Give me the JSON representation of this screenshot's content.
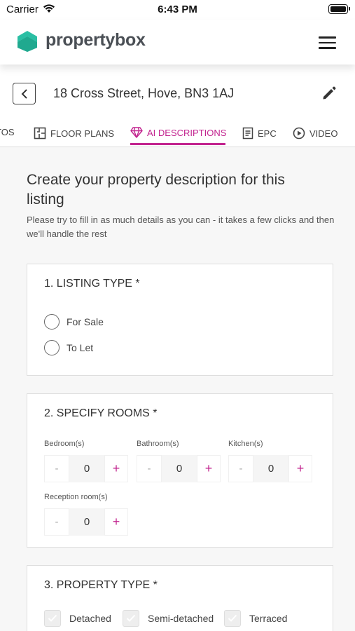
{
  "status_bar": {
    "carrier": "Carrier",
    "time": "6:43 PM"
  },
  "header": {
    "brand": "propertybox"
  },
  "address_bar": {
    "address": "18 Cross Street, Hove, BN3 1AJ"
  },
  "tabs": [
    {
      "label": "TOS",
      "icon": "photos-icon",
      "active": false
    },
    {
      "label": "FLOOR PLANS",
      "icon": "floor-plan-icon",
      "active": false
    },
    {
      "label": "AI DESCRIPTIONS",
      "icon": "diamond-icon",
      "active": true
    },
    {
      "label": "EPC",
      "icon": "document-icon",
      "active": false
    },
    {
      "label": "VIDEO",
      "icon": "play-icon",
      "active": false
    }
  ],
  "colors": {
    "accent": "#c2248f",
    "brand": "#2bbfa4"
  },
  "main": {
    "heading": "Create your property description for this listing",
    "subtext": "Please try to fill in as much details as you can - it takes a few clicks and then we'll handle the rest"
  },
  "listing_type": {
    "title": "1. LISTING TYPE *",
    "options": [
      "For Sale",
      "To Let"
    ]
  },
  "rooms": {
    "title": "2. SPECIFY ROOMS *",
    "items": [
      {
        "label": "Bedroom(s)",
        "value": "0"
      },
      {
        "label": "Bathroom(s)",
        "value": "0"
      },
      {
        "label": "Kitchen(s)",
        "value": "0"
      },
      {
        "label": "Reception room(s)",
        "value": "0"
      }
    ],
    "minus": "-",
    "plus": "+"
  },
  "property_type": {
    "title": "3. PROPERTY TYPE *",
    "options": [
      "Detached",
      "Semi-detached",
      "Terraced"
    ]
  }
}
